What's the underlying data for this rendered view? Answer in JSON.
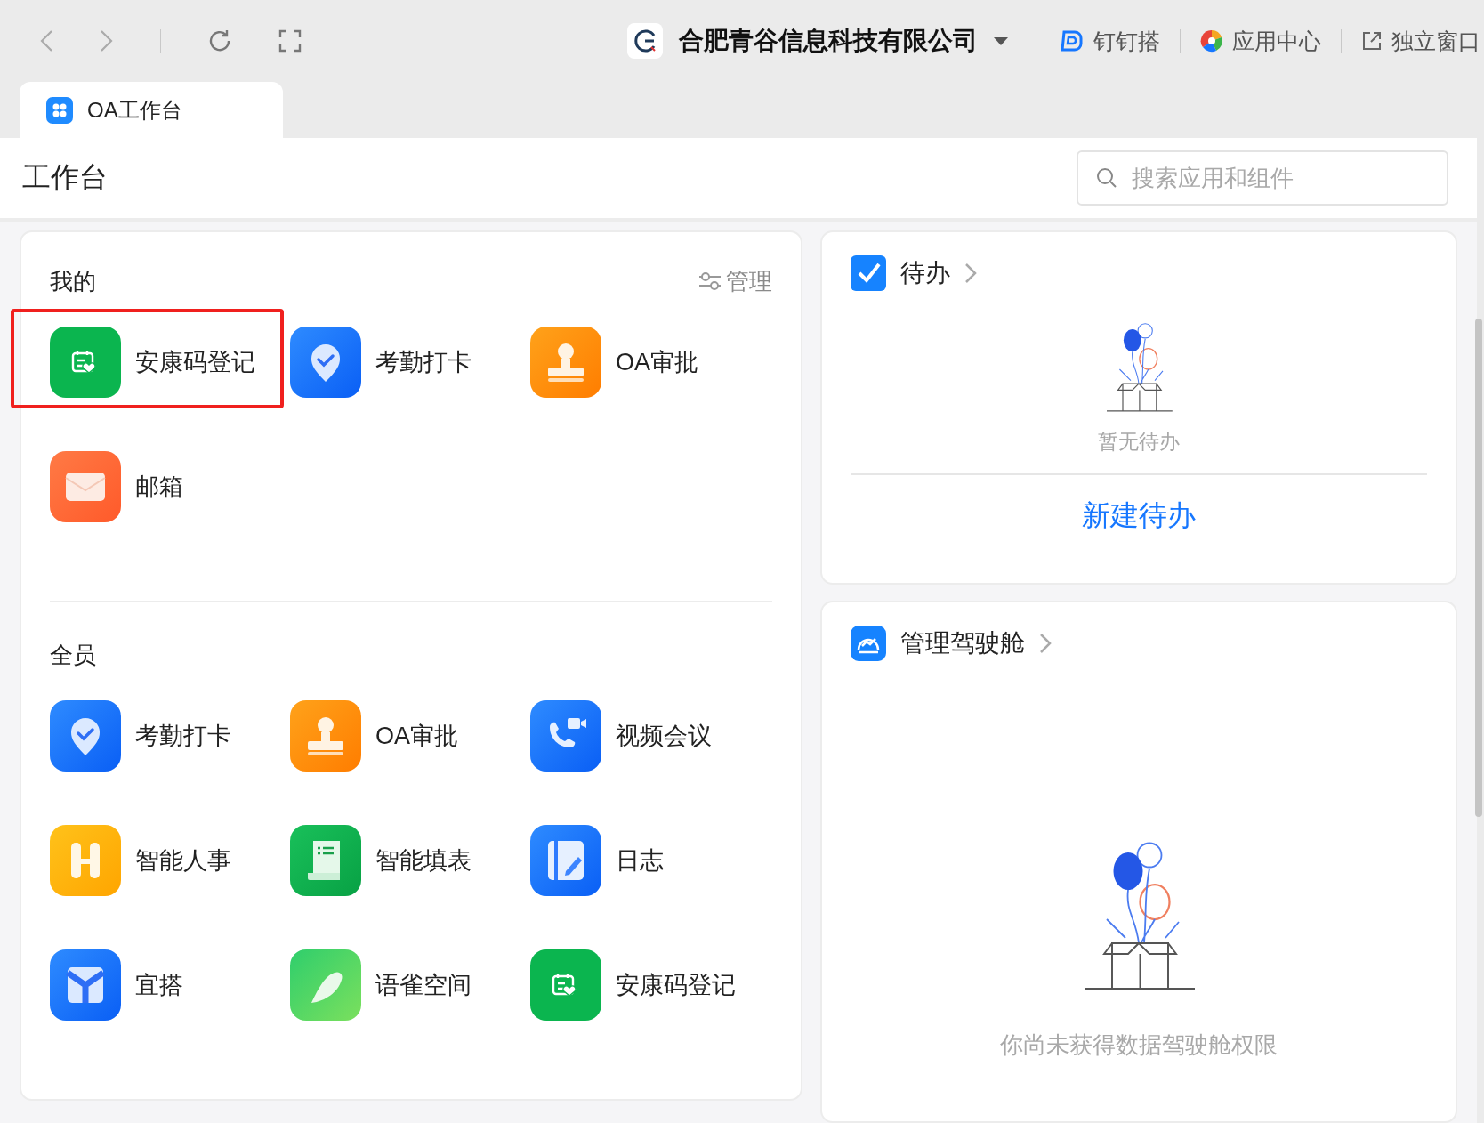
{
  "browser": {
    "company": "合肥青谷信息科技有限公司",
    "links": [
      {
        "kind": "dingda",
        "label": "钉钉搭"
      },
      {
        "kind": "appcenter",
        "label": "应用中心"
      },
      {
        "kind": "window",
        "label": "独立窗口"
      }
    ]
  },
  "tabs": [
    {
      "label": "OA工作台",
      "selected": true
    }
  ],
  "header": {
    "title": "工作台",
    "search": {
      "placeholder": "搜索应用和组件"
    }
  },
  "sections": [
    {
      "title": "我的",
      "action": "管理",
      "apps": [
        {
          "kind": "health",
          "label": "安康码登记",
          "highlighted": true
        },
        {
          "kind": "attendance",
          "label": "考勤打卡",
          "highlighted": false
        },
        {
          "kind": "approval",
          "label": "OA审批",
          "highlighted": false
        },
        {
          "kind": "mail",
          "label": "邮箱",
          "highlighted": false
        }
      ]
    },
    {
      "title": "全员",
      "apps": [
        {
          "kind": "attendance",
          "label": "考勤打卡",
          "highlighted": false
        },
        {
          "kind": "approval",
          "label": "OA审批",
          "highlighted": false
        },
        {
          "kind": "video",
          "label": "视频会议",
          "highlighted": false
        },
        {
          "kind": "hr",
          "label": "智能人事",
          "highlighted": false
        },
        {
          "kind": "form",
          "label": "智能填表",
          "highlighted": false
        },
        {
          "kind": "log",
          "label": "日志",
          "highlighted": false
        },
        {
          "kind": "yida",
          "label": "宜搭",
          "highlighted": false
        },
        {
          "kind": "yuque",
          "label": "语雀空间",
          "highlighted": false
        },
        {
          "kind": "health",
          "label": "安康码登记",
          "highlighted": false
        }
      ]
    }
  ],
  "todo": {
    "title": "待办",
    "empty": "暂无待办",
    "action": "新建待办"
  },
  "cockpit": {
    "title": "管理驾驶舱",
    "empty": "你尚未获得数据驾驶舱权限"
  }
}
